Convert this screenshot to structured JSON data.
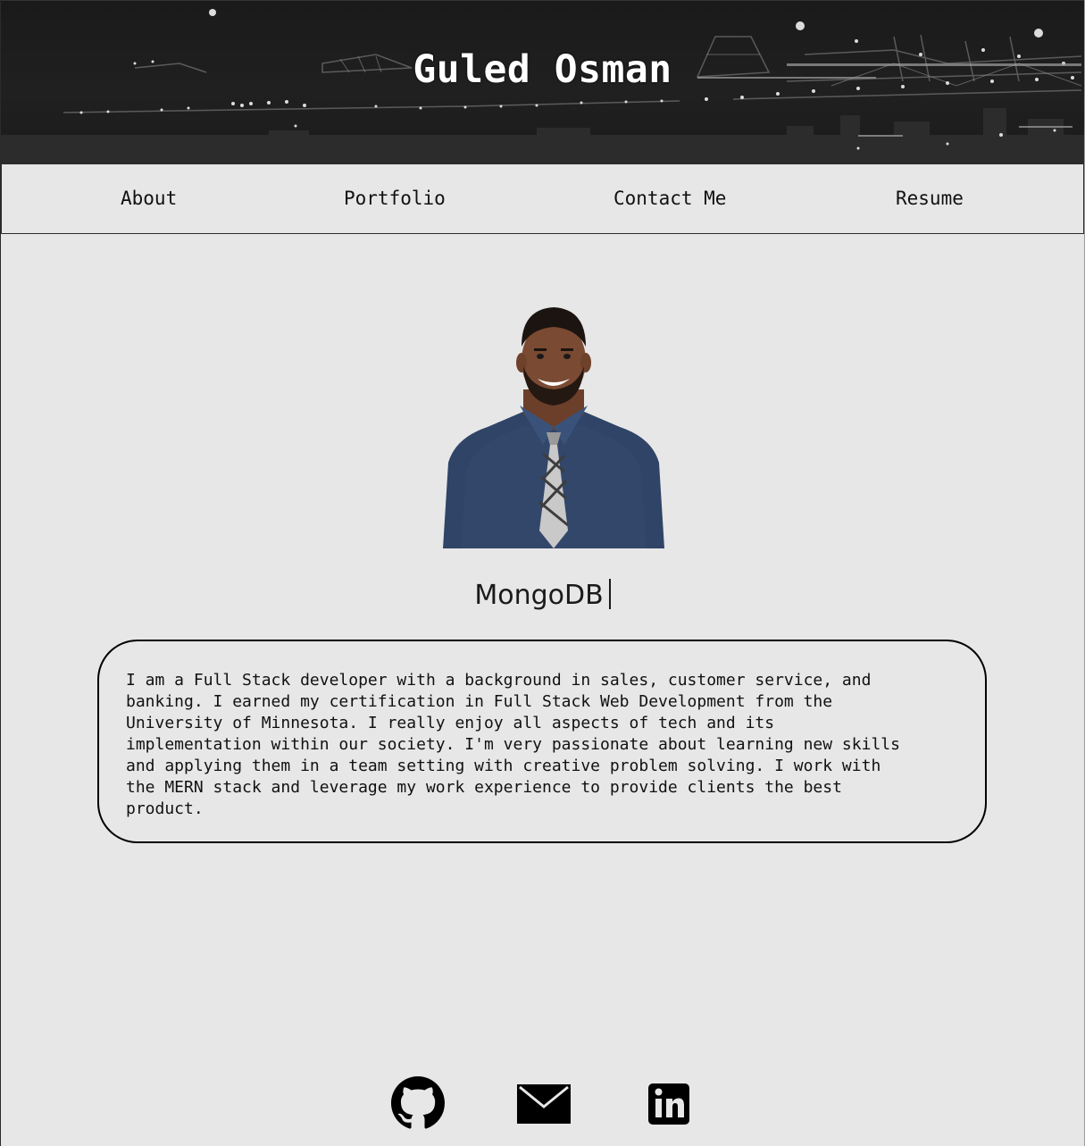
{
  "header": {
    "title": "Guled Osman"
  },
  "nav": {
    "items": [
      {
        "label": "About"
      },
      {
        "label": "Portfolio"
      },
      {
        "label": "Contact Me"
      },
      {
        "label": "Resume"
      }
    ]
  },
  "profile": {
    "typed_text": "MongoDB",
    "about_lines": [
      "I am a Full Stack developer with a background in sales, customer service, and",
      "banking. I earned my certification in Full Stack Web Development from the",
      "University of Minnesota. I really enjoy all aspects of tech and its",
      "implementation within our society. I'm very passionate about learning new skills",
      "and applying them in a team setting with creative problem solving. I work with",
      "the MERN stack and leverage my work experience to provide clients the best",
      "product."
    ]
  },
  "footer": {
    "icons": [
      "github-icon",
      "email-icon",
      "linkedin-icon"
    ]
  },
  "colors": {
    "background": "#e7e7e7",
    "banner": "#1d1d1d",
    "text": "#111111",
    "icon": "#000000"
  }
}
